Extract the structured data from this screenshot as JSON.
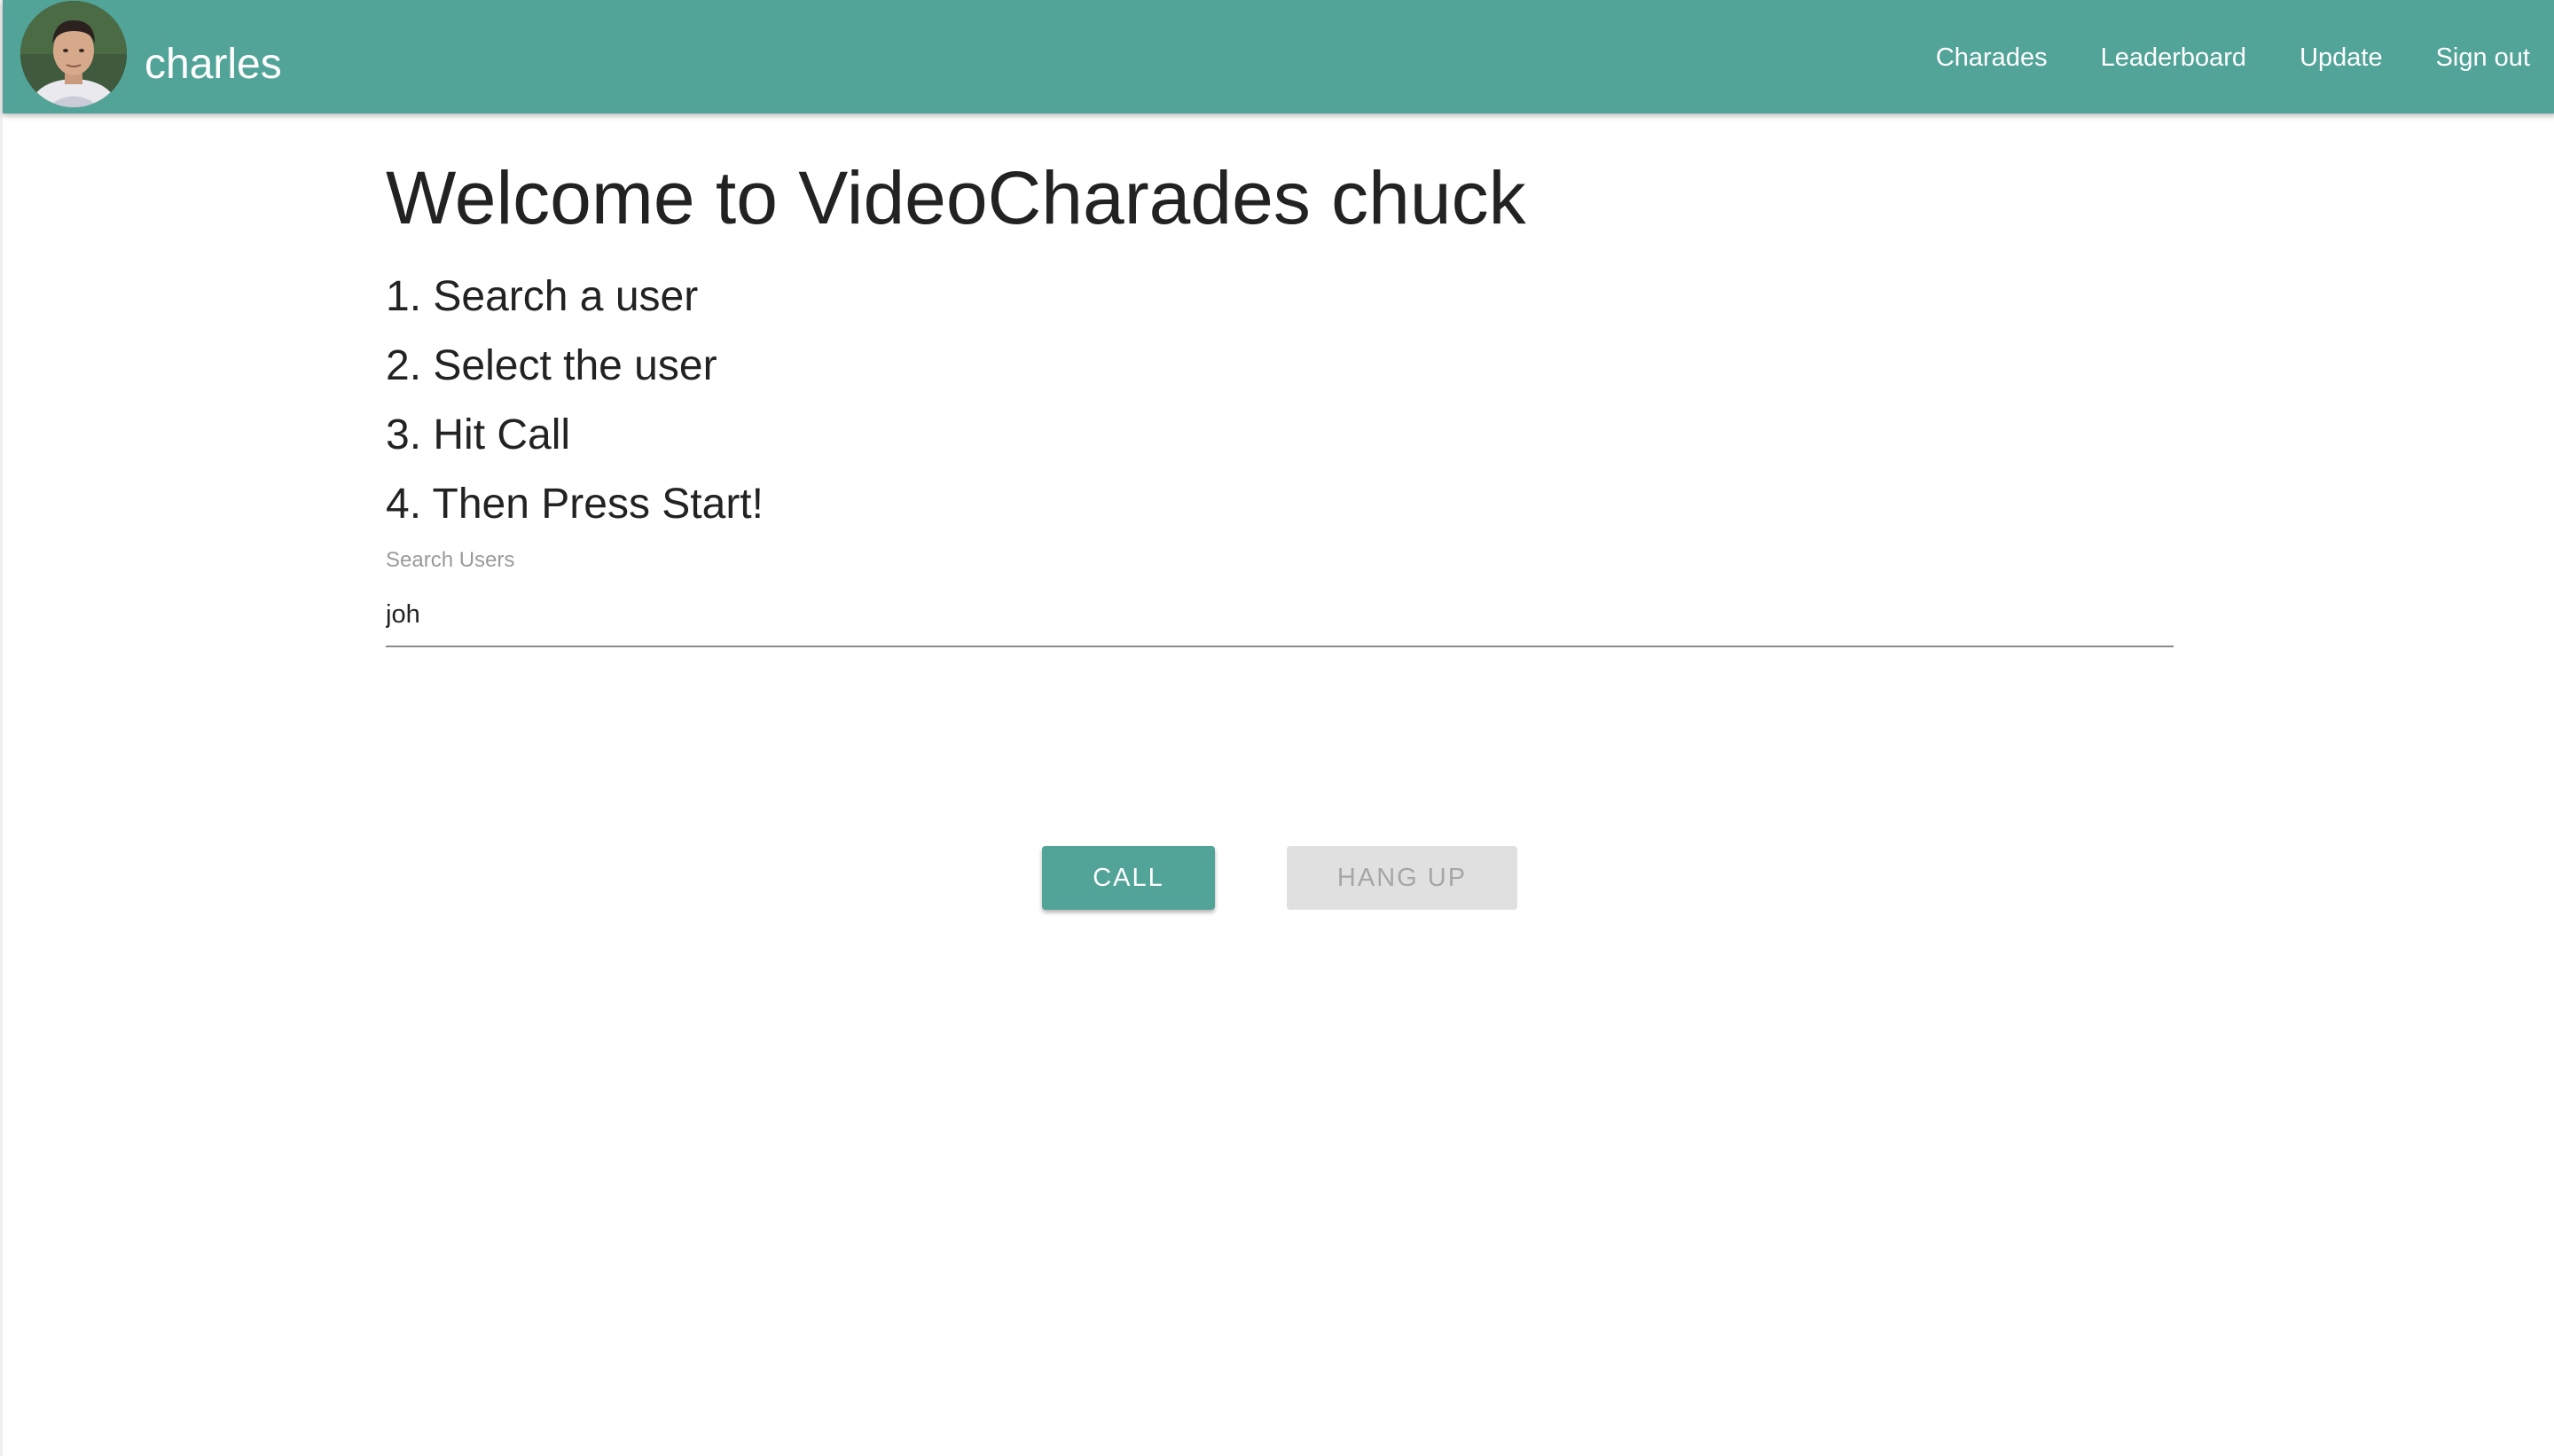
{
  "header": {
    "user_name": "charles",
    "avatar_icon": "user-avatar-photo",
    "nav": [
      "Charades",
      "Leaderboard",
      "Update",
      "Sign out"
    ]
  },
  "main": {
    "title": "Welcome to VideoCharades chuck",
    "steps": [
      "1. Search a user",
      "2. Select the user",
      "3. Hit Call",
      "4. Then Press Start!"
    ],
    "search": {
      "label": "Search Users",
      "value": "joh"
    },
    "buttons": {
      "call_label": "CALL",
      "hangup_label": "HANG UP"
    }
  },
  "colors": {
    "primary": "#52a398",
    "disabled_bg": "#e0e0e0",
    "disabled_text": "#a6a6a6"
  }
}
